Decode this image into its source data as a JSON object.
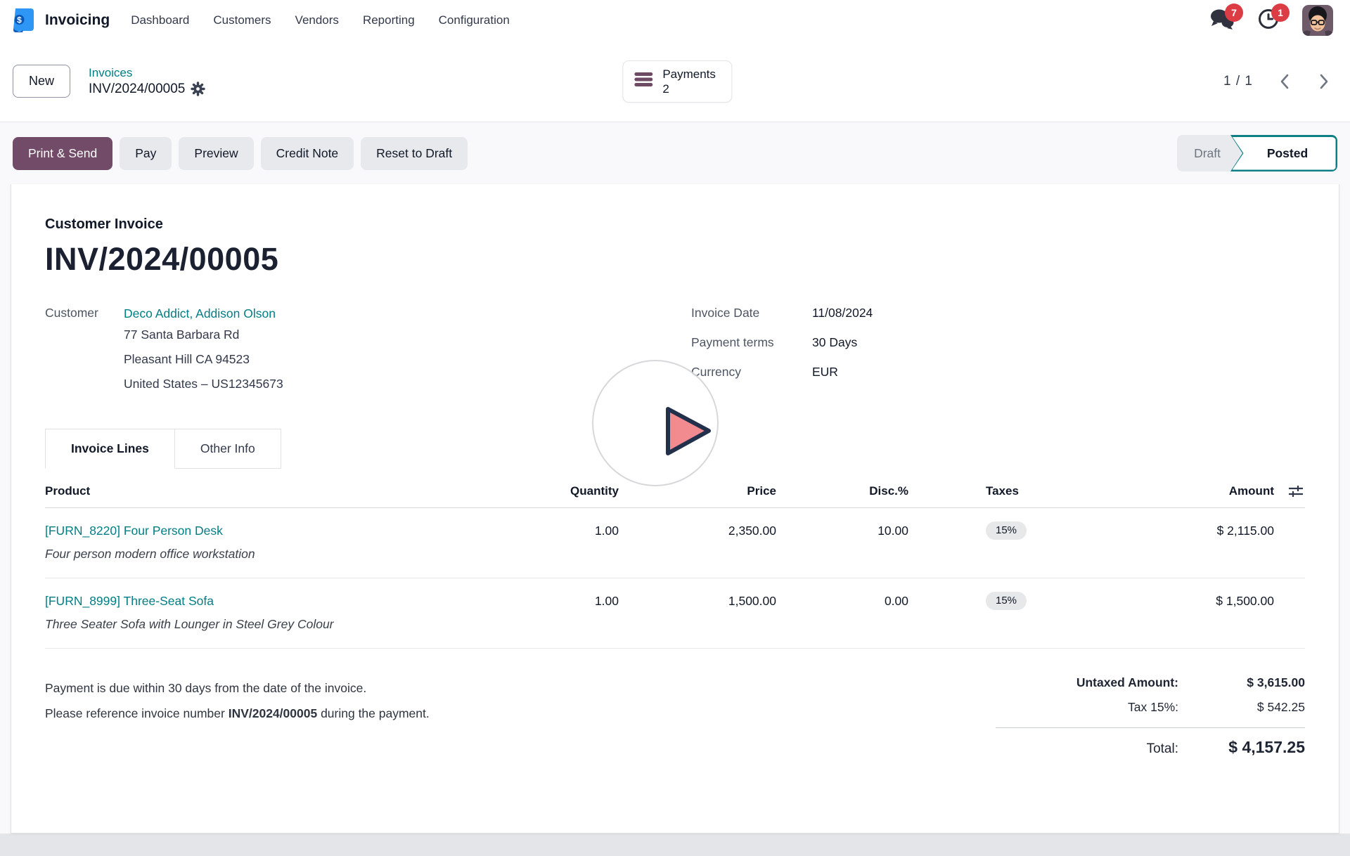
{
  "nav": {
    "brand": "Invoicing",
    "items": [
      "Dashboard",
      "Customers",
      "Vendors",
      "Reporting",
      "Configuration"
    ],
    "badges": {
      "messages": "7",
      "activities": "1"
    }
  },
  "control_panel": {
    "new_button": "New",
    "breadcrumb_parent": "Invoices",
    "breadcrumb_current": "INV/2024/00005",
    "payments_button": {
      "label": "Payments",
      "count": "2"
    },
    "pager": "1 / 1"
  },
  "actions": {
    "primary": "Print & Send",
    "secondary": [
      "Pay",
      "Preview",
      "Credit Note",
      "Reset to Draft"
    ],
    "status": {
      "draft": "Draft",
      "posted": "Posted"
    }
  },
  "invoice": {
    "type_label": "Customer Invoice",
    "number": "INV/2024/00005",
    "customer_label": "Customer",
    "customer_name": "Deco Addict, Addison Olson",
    "address_lines": [
      "77 Santa Barbara Rd",
      "Pleasant Hill CA 94523",
      "United States – US12345673"
    ],
    "fields": [
      {
        "label": "Invoice Date",
        "value": "11/08/2024"
      },
      {
        "label": "Payment terms",
        "value": "30 Days"
      },
      {
        "label": "Currency",
        "value": "EUR"
      }
    ],
    "tabs": [
      "Invoice Lines",
      "Other Info"
    ],
    "table": {
      "headers": [
        "Product",
        "Quantity",
        "Price",
        "Disc.%",
        "Taxes",
        "Amount"
      ],
      "rows": [
        {
          "product": "[FURN_8220] Four Person Desk",
          "description": "Four person modern office workstation",
          "quantity": "1.00",
          "price": "2,350.00",
          "disc": "10.00",
          "tax": "15%",
          "amount": "$ 2,115.00"
        },
        {
          "product": "[FURN_8999] Three-Seat Sofa",
          "description": "Three Seater Sofa with Lounger in Steel Grey Colour",
          "quantity": "1.00",
          "price": "1,500.00",
          "disc": "0.00",
          "tax": "15%",
          "amount": "$ 1,500.00"
        }
      ]
    },
    "terms_line1": "Payment is due within 30 days from the date of the invoice.",
    "terms_line2_prefix": "Please reference invoice number ",
    "terms_line2_bold": "INV/2024/00005",
    "terms_line2_suffix": " during the payment.",
    "totals": [
      {
        "label": "Untaxed Amount:",
        "value": "$ 3,615.00"
      },
      {
        "label": "Tax 15%:",
        "value": "$ 542.25"
      },
      {
        "label": "Total:",
        "value": "$ 4,157.25"
      }
    ]
  },
  "colors": {
    "accent_teal": "#017e84",
    "primary_purple": "#714B67",
    "badge_red": "#dc3d45",
    "posted_border_teal": "#0e8085"
  }
}
